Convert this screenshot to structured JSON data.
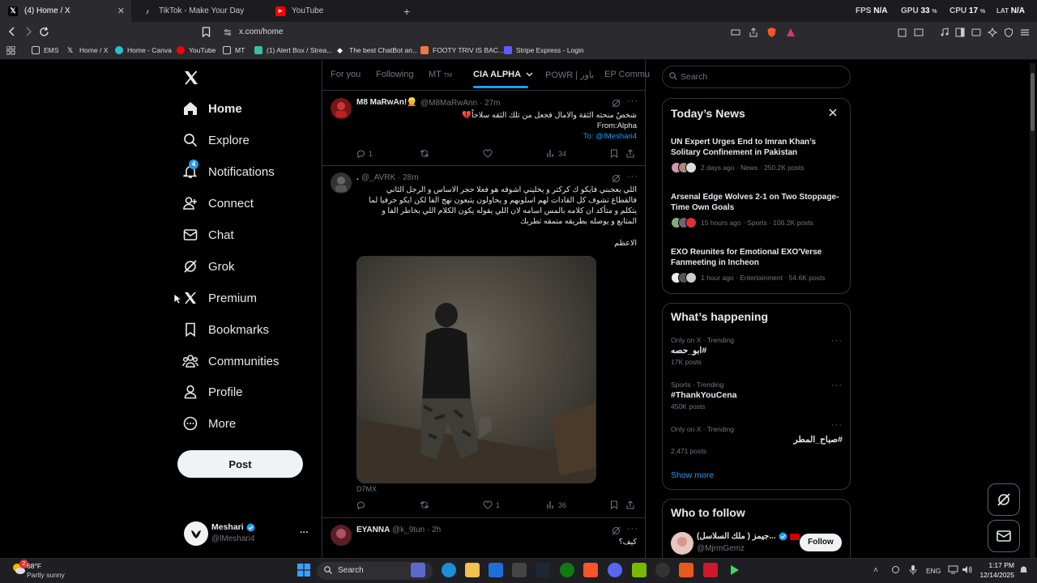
{
  "browser": {
    "tabs": [
      {
        "title": "(4) Home / X",
        "active": true
      },
      {
        "title": "TikTok - Make Your Day",
        "active": false
      },
      {
        "title": "YouTube",
        "active": false
      }
    ],
    "stats": {
      "fps_label": "FPS",
      "fps_value": "N/A",
      "gpu_label": "GPU",
      "gpu_value": "33",
      "cpu_label": "CPU",
      "cpu_value": "17",
      "lat_label": "LAT",
      "lat_value": "N/A",
      "pct": "%"
    },
    "url": "x.com/home",
    "bookmarks": [
      "EMS",
      "Home / X",
      "Home - Canva",
      "YouTube",
      "MT",
      "(1) Alert Box / Strea...",
      "The best ChatBot an...",
      "FOOTY TRIV IS BAC...",
      "Stripe Express - Login"
    ]
  },
  "nav": {
    "items": [
      "Home",
      "Explore",
      "Notifications",
      "Connect",
      "Chat",
      "Grok",
      "Premium",
      "Bookmarks",
      "Communities",
      "Profile",
      "More"
    ],
    "notifications_badge": "4",
    "post_label": "Post",
    "account": {
      "name": "Meshari",
      "handle": "@lMeshari4",
      "more": "···"
    }
  },
  "timeline": {
    "tabs": [
      "For you",
      "Following",
      "MT",
      "CIA ALPHA",
      "POWR | باور",
      "EP Commu"
    ],
    "mt_suffix": "TM",
    "tweets": [
      {
        "name": "M8 MaRwAn!👱",
        "handle": "@M8MaRwAnn · 27m",
        "lines": [
          "شخصٌ منحته الثقة والامال فجعل من تلك الثقه سلاحاً💔",
          "From:Alpha",
          "To: @lMeshari4"
        ],
        "replies": "1",
        "retweets": "",
        "likes": "",
        "views": "34"
      },
      {
        "name": ".",
        "handle": "@_AVRK · 28m",
        "lines": [
          "اللي يعجبني فايكو ك كركتر و يخليني اشوفه هو فعلا حجر الاساس و الرجل الثاني",
          "فالقطاع تشوف كل القادات لهم اسلوبهم و يحاولون يتبعون نهج الفا لكن ايكو حرفيا لما",
          "يتكلم و متأكد ان كلامه بالمس اسامه لان اللي يقوله يكون الكلام اللي بخاطر الفا و",
          "المتابع و يوصله بطريقه منمقه تطربك",
          "الاعظم"
        ],
        "media_caption": "D7MX",
        "replies": "",
        "retweets": "",
        "likes": "1",
        "views": "36"
      },
      {
        "name": "EYANNA",
        "handle": "@k_9tun · 2h",
        "lines": [
          "كيف؟"
        ]
      }
    ]
  },
  "sidebar": {
    "search_placeholder": "Search",
    "todays_news": {
      "title": "Today’s News",
      "items": [
        {
          "headline": "UN Expert Urges End to Imran Khan’s Solitary Confinement in Pakistan",
          "meta": "2 days ago · News · 250.2K posts"
        },
        {
          "headline": "Arsenal Edge Wolves 2-1 on Two Stoppage-Time Own Goals",
          "meta": "15 hours ago · Sports · 106.2K posts"
        },
        {
          "headline": "EXO Reunites for Emotional EXO'Verse Fanmeeting in Incheon",
          "meta": "1 hour ago · Entertainment · 54.6K posts"
        }
      ]
    },
    "whats_happening": {
      "title": "What’s happening",
      "items": [
        {
          "context": "Only on X · Trending",
          "topic": "#ابو_حصه",
          "posts": "17K posts"
        },
        {
          "context": "Sports · Trending",
          "topic": "#ThankYouCena",
          "posts": "450K posts"
        },
        {
          "context": "Only on X · Trending",
          "topic": "#صباح_المطر",
          "posts": "2,471 posts"
        }
      ],
      "show_more": "Show more"
    },
    "who_to_follow": {
      "title": "Who to follow",
      "user": {
        "name": "(ملك السلاسل ) جيمز...",
        "handle": "@MjrmGemz",
        "follow": "Follow"
      }
    }
  },
  "taskbar": {
    "weather_temp": "68°F",
    "weather_desc": "Partly sunny",
    "weather_badge": "2",
    "search": "Search",
    "lang": "ENG",
    "time": "1:17 PM",
    "date": "12/14/2025"
  },
  "colors": {
    "accent": "#1d9bf0",
    "background": "#000000",
    "border": "#2f3336",
    "muted": "#71767b"
  }
}
